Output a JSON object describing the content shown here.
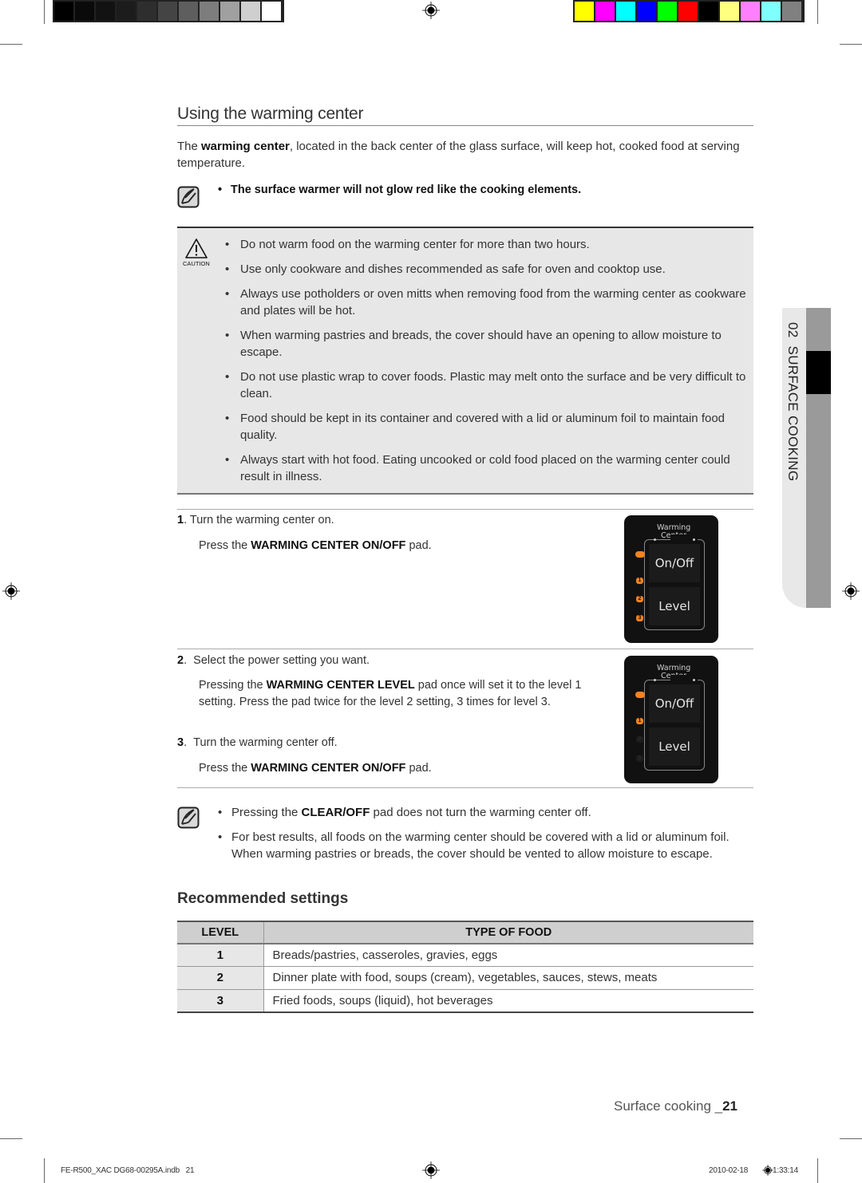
{
  "print_marks": {
    "grayscale_swatches": [
      "#000000",
      "#0a0a0a",
      "#121212",
      "#1c1c1c",
      "#2e2e2e",
      "#444444",
      "#5e5e5e",
      "#7d7d7d",
      "#a0a0a0",
      "#cfcfcf",
      "#ffffff"
    ],
    "color_swatches": [
      "#ffff00",
      "#ff00ff",
      "#00ffff",
      "#0000ff",
      "#00ff00",
      "#ff0000",
      "#000000",
      "#ffff80",
      "#ff80ff",
      "#80ffff",
      "#808080"
    ]
  },
  "heading": "Using the warming center",
  "intro": {
    "prefix": "The ",
    "bold": "warming center",
    "suffix": ", located in the back center of the glass surface, will keep hot, cooked food at serving temperature."
  },
  "note_top": {
    "icon": "note-pencil-icon",
    "text": "The surface warmer will not glow red like the cooking elements."
  },
  "caution": {
    "icon": "caution-triangle-icon",
    "icon_label": "CAUTION",
    "items": [
      "Do not warm food on the warming center for more than two hours.",
      "Use only cookware and dishes recommended as safe for oven and cooktop use.",
      "Always use potholders or oven mitts when removing food from the warming center as cookware and plates will be hot.",
      "When warming pastries and breads, the cover should have an opening to allow moisture to escape.",
      "Do not use plastic wrap to cover foods. Plastic may melt onto the surface and be very difficult to clean.",
      "Food should be kept in its container and covered with a lid or aluminum foil to maintain food quality.",
      "Always start with hot food. Eating uncooked or cold food placed on the warming center could result in illness."
    ]
  },
  "steps": [
    {
      "number": "1",
      "title": "Turn the warming center on.",
      "detail_prefix": "Press the ",
      "detail_bold": "WARMING CENTER ON/OFF",
      "detail_suffix": " pad."
    },
    {
      "number": "2",
      "title": "Select the power setting you want.",
      "detail_prefix": "Pressing the ",
      "detail_bold": "WARMING CENTER LEVEL",
      "detail_suffix": " pad once will set it to the level 1 setting. Press the pad twice for the level 2 setting, 3 times for level 3."
    },
    {
      "number": "3",
      "title": "Turn the warming center off.",
      "detail_prefix": "Press the ",
      "detail_bold": "WARMING CENTER ON/OFF",
      "detail_suffix": " pad."
    }
  ],
  "panels": [
    {
      "title_line1": "Warming",
      "title_line2": "Center",
      "onoff_label": "On/Off",
      "level_label": "Level",
      "power_led_on": true,
      "level_leds": [
        {
          "label": "1",
          "on": true
        },
        {
          "label": "2",
          "on": true
        },
        {
          "label": "3",
          "on": true
        }
      ]
    },
    {
      "title_line1": "Warming",
      "title_line2": "Center",
      "onoff_label": "On/Off",
      "level_label": "Level",
      "power_led_on": true,
      "level_leds": [
        {
          "label": "1",
          "on": true
        },
        {
          "label": "2",
          "on": false
        },
        {
          "label": "3",
          "on": false
        }
      ]
    }
  ],
  "led_color": "#f58220",
  "note_bottom": {
    "icon": "note-pencil-icon",
    "item1_prefix": "Pressing the ",
    "item1_bold": "CLEAR/OFF",
    "item1_suffix": " pad does not turn the warming center off.",
    "item2": "For best results, all foods on the warming center should be covered with a lid or aluminum foil. When warming pastries or breads, the cover should be vented to allow moisture to escape."
  },
  "recommended": {
    "heading": "Recommended settings",
    "columns": [
      "LEVEL",
      "TYPE OF FOOD"
    ],
    "rows": [
      {
        "level": "1",
        "food": "Breads/pastries, casseroles, gravies, eggs"
      },
      {
        "level": "2",
        "food": "Dinner plate with food, soups (cream), vegetables, sauces, stews, meats"
      },
      {
        "level": "3",
        "food": "Fried foods, soups (liquid), hot beverages"
      }
    ]
  },
  "side_tab": {
    "label": "02  SURFACE COOKING"
  },
  "footer": {
    "section": "Surface cooking _",
    "page": "21"
  },
  "slug": {
    "file": "FE-R500_XAC DG68-00295A.indb   21",
    "date": "2010-02-18",
    "time": "1:33:14"
  }
}
